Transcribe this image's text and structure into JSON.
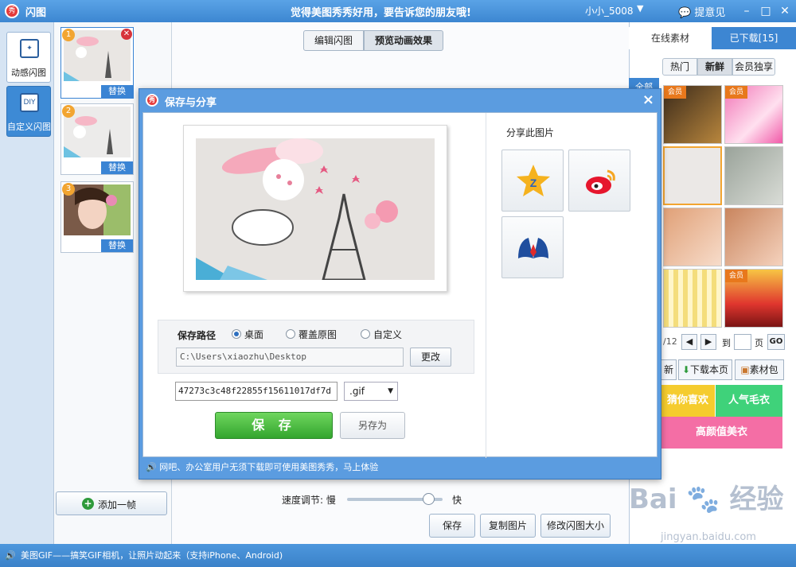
{
  "titlebar": {
    "app_title": "闪图",
    "slogan": "觉得美图秀秀好用，要告诉您的朋友哦!",
    "user": "小小_5008",
    "feedback": "提意见",
    "logo_text": "秀"
  },
  "tools": [
    {
      "label": "动感闪图",
      "icon": "sparkle-frame-icon"
    },
    {
      "label": "自定义闪图",
      "icon_text": "DIY"
    }
  ],
  "frames": [
    {
      "number": "1",
      "replace": "替换"
    },
    {
      "number": "2",
      "replace": "替换"
    },
    {
      "number": "3",
      "replace": "替换"
    }
  ],
  "add_frame": "添加一帧",
  "center_tabs": [
    "编辑闪图",
    "预览动画效果"
  ],
  "speed": {
    "label": "速度调节:",
    "slow": "慢",
    "fast": "快",
    "value": 0.85
  },
  "bottom_buttons": [
    "保存",
    "复制图片",
    "修改闪图大小"
  ],
  "right_panel": {
    "tabs": [
      "在线素材",
      "已下载[15]"
    ],
    "chips": [
      "热门",
      "新鲜",
      "会员独享"
    ],
    "side_tab": "全部",
    "vip_badge": "会员",
    "page_text": "/12",
    "goto": "到",
    "page_unit": "页",
    "go": "GO",
    "refresh": "新",
    "download_page": "下载本页",
    "material_pack": "素材包",
    "banners": [
      "猜你喜欢",
      "人气毛衣",
      "高颜值美衣"
    ],
    "banner_colors": [
      "#f5cc2e",
      "#3fd27a",
      "#f46ea5"
    ]
  },
  "status_bar": "美图GIF——搞笑GIF相机，让照片动起来（支持iPhone、Android)",
  "watermark": {
    "brand": "Bai",
    "brand2": "经验",
    "url": "jingyan.baidu.com"
  },
  "dialog": {
    "title": "保存与分享",
    "close": "×",
    "path_label": "保存路径",
    "options": [
      "桌面",
      "覆盖原图",
      "自定义"
    ],
    "selected_option": "桌面",
    "path_value": "C:\\Users\\xiaozhu\\Desktop",
    "change": "更改",
    "filename": "47273c3c48f22855f15611017df7d",
    "extension": ".gif",
    "save": "保 存",
    "save_as": "另存为",
    "share_heading": "分享此图片",
    "share_targets": [
      "qzone",
      "weibo",
      "renren"
    ],
    "footer": "网吧、办公室用户无须下载即可使用美图秀秀，马上体验"
  }
}
